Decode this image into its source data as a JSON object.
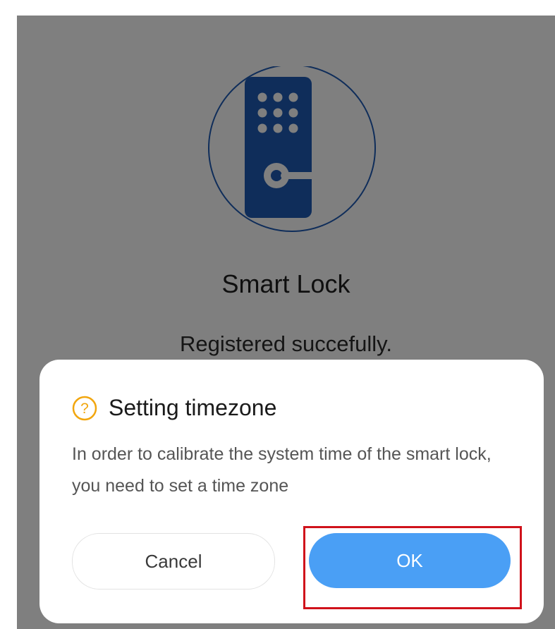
{
  "device": {
    "name": "Smart Lock",
    "status": "Registered succefully.",
    "icon": "smart-lock-icon",
    "icon_color": "#1e5bb5"
  },
  "dialog": {
    "icon": "question-circle-icon",
    "icon_color": "#f2a60e",
    "title": "Setting timezone",
    "message": "In order to calibrate the system time of the smart lock, you need to set a time zone",
    "cancel_label": "Cancel",
    "ok_label": "OK",
    "ok_color": "#4a9ff5"
  },
  "annotation": {
    "highlight_color": "#d0121b"
  }
}
